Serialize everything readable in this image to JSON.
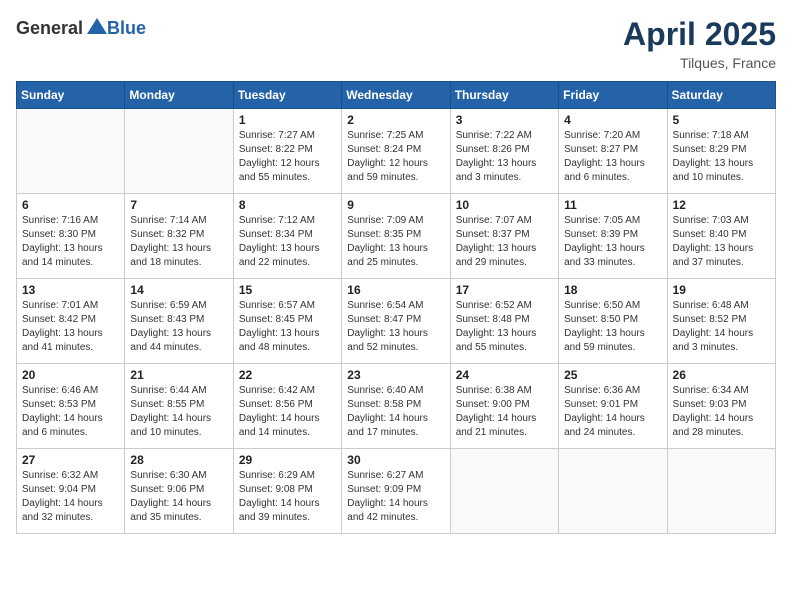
{
  "header": {
    "logo_general": "General",
    "logo_blue": "Blue",
    "month": "April 2025",
    "location": "Tilques, France"
  },
  "weekdays": [
    "Sunday",
    "Monday",
    "Tuesday",
    "Wednesday",
    "Thursday",
    "Friday",
    "Saturday"
  ],
  "weeks": [
    [
      {
        "day": "",
        "sunrise": "",
        "sunset": "",
        "daylight": ""
      },
      {
        "day": "",
        "sunrise": "",
        "sunset": "",
        "daylight": ""
      },
      {
        "day": "1",
        "sunrise": "Sunrise: 7:27 AM",
        "sunset": "Sunset: 8:22 PM",
        "daylight": "Daylight: 12 hours and 55 minutes."
      },
      {
        "day": "2",
        "sunrise": "Sunrise: 7:25 AM",
        "sunset": "Sunset: 8:24 PM",
        "daylight": "Daylight: 12 hours and 59 minutes."
      },
      {
        "day": "3",
        "sunrise": "Sunrise: 7:22 AM",
        "sunset": "Sunset: 8:26 PM",
        "daylight": "Daylight: 13 hours and 3 minutes."
      },
      {
        "day": "4",
        "sunrise": "Sunrise: 7:20 AM",
        "sunset": "Sunset: 8:27 PM",
        "daylight": "Daylight: 13 hours and 6 minutes."
      },
      {
        "day": "5",
        "sunrise": "Sunrise: 7:18 AM",
        "sunset": "Sunset: 8:29 PM",
        "daylight": "Daylight: 13 hours and 10 minutes."
      }
    ],
    [
      {
        "day": "6",
        "sunrise": "Sunrise: 7:16 AM",
        "sunset": "Sunset: 8:30 PM",
        "daylight": "Daylight: 13 hours and 14 minutes."
      },
      {
        "day": "7",
        "sunrise": "Sunrise: 7:14 AM",
        "sunset": "Sunset: 8:32 PM",
        "daylight": "Daylight: 13 hours and 18 minutes."
      },
      {
        "day": "8",
        "sunrise": "Sunrise: 7:12 AM",
        "sunset": "Sunset: 8:34 PM",
        "daylight": "Daylight: 13 hours and 22 minutes."
      },
      {
        "day": "9",
        "sunrise": "Sunrise: 7:09 AM",
        "sunset": "Sunset: 8:35 PM",
        "daylight": "Daylight: 13 hours and 25 minutes."
      },
      {
        "day": "10",
        "sunrise": "Sunrise: 7:07 AM",
        "sunset": "Sunset: 8:37 PM",
        "daylight": "Daylight: 13 hours and 29 minutes."
      },
      {
        "day": "11",
        "sunrise": "Sunrise: 7:05 AM",
        "sunset": "Sunset: 8:39 PM",
        "daylight": "Daylight: 13 hours and 33 minutes."
      },
      {
        "day": "12",
        "sunrise": "Sunrise: 7:03 AM",
        "sunset": "Sunset: 8:40 PM",
        "daylight": "Daylight: 13 hours and 37 minutes."
      }
    ],
    [
      {
        "day": "13",
        "sunrise": "Sunrise: 7:01 AM",
        "sunset": "Sunset: 8:42 PM",
        "daylight": "Daylight: 13 hours and 41 minutes."
      },
      {
        "day": "14",
        "sunrise": "Sunrise: 6:59 AM",
        "sunset": "Sunset: 8:43 PM",
        "daylight": "Daylight: 13 hours and 44 minutes."
      },
      {
        "day": "15",
        "sunrise": "Sunrise: 6:57 AM",
        "sunset": "Sunset: 8:45 PM",
        "daylight": "Daylight: 13 hours and 48 minutes."
      },
      {
        "day": "16",
        "sunrise": "Sunrise: 6:54 AM",
        "sunset": "Sunset: 8:47 PM",
        "daylight": "Daylight: 13 hours and 52 minutes."
      },
      {
        "day": "17",
        "sunrise": "Sunrise: 6:52 AM",
        "sunset": "Sunset: 8:48 PM",
        "daylight": "Daylight: 13 hours and 55 minutes."
      },
      {
        "day": "18",
        "sunrise": "Sunrise: 6:50 AM",
        "sunset": "Sunset: 8:50 PM",
        "daylight": "Daylight: 13 hours and 59 minutes."
      },
      {
        "day": "19",
        "sunrise": "Sunrise: 6:48 AM",
        "sunset": "Sunset: 8:52 PM",
        "daylight": "Daylight: 14 hours and 3 minutes."
      }
    ],
    [
      {
        "day": "20",
        "sunrise": "Sunrise: 6:46 AM",
        "sunset": "Sunset: 8:53 PM",
        "daylight": "Daylight: 14 hours and 6 minutes."
      },
      {
        "day": "21",
        "sunrise": "Sunrise: 6:44 AM",
        "sunset": "Sunset: 8:55 PM",
        "daylight": "Daylight: 14 hours and 10 minutes."
      },
      {
        "day": "22",
        "sunrise": "Sunrise: 6:42 AM",
        "sunset": "Sunset: 8:56 PM",
        "daylight": "Daylight: 14 hours and 14 minutes."
      },
      {
        "day": "23",
        "sunrise": "Sunrise: 6:40 AM",
        "sunset": "Sunset: 8:58 PM",
        "daylight": "Daylight: 14 hours and 17 minutes."
      },
      {
        "day": "24",
        "sunrise": "Sunrise: 6:38 AM",
        "sunset": "Sunset: 9:00 PM",
        "daylight": "Daylight: 14 hours and 21 minutes."
      },
      {
        "day": "25",
        "sunrise": "Sunrise: 6:36 AM",
        "sunset": "Sunset: 9:01 PM",
        "daylight": "Daylight: 14 hours and 24 minutes."
      },
      {
        "day": "26",
        "sunrise": "Sunrise: 6:34 AM",
        "sunset": "Sunset: 9:03 PM",
        "daylight": "Daylight: 14 hours and 28 minutes."
      }
    ],
    [
      {
        "day": "27",
        "sunrise": "Sunrise: 6:32 AM",
        "sunset": "Sunset: 9:04 PM",
        "daylight": "Daylight: 14 hours and 32 minutes."
      },
      {
        "day": "28",
        "sunrise": "Sunrise: 6:30 AM",
        "sunset": "Sunset: 9:06 PM",
        "daylight": "Daylight: 14 hours and 35 minutes."
      },
      {
        "day": "29",
        "sunrise": "Sunrise: 6:29 AM",
        "sunset": "Sunset: 9:08 PM",
        "daylight": "Daylight: 14 hours and 39 minutes."
      },
      {
        "day": "30",
        "sunrise": "Sunrise: 6:27 AM",
        "sunset": "Sunset: 9:09 PM",
        "daylight": "Daylight: 14 hours and 42 minutes."
      },
      {
        "day": "",
        "sunrise": "",
        "sunset": "",
        "daylight": ""
      },
      {
        "day": "",
        "sunrise": "",
        "sunset": "",
        "daylight": ""
      },
      {
        "day": "",
        "sunrise": "",
        "sunset": "",
        "daylight": ""
      }
    ]
  ]
}
